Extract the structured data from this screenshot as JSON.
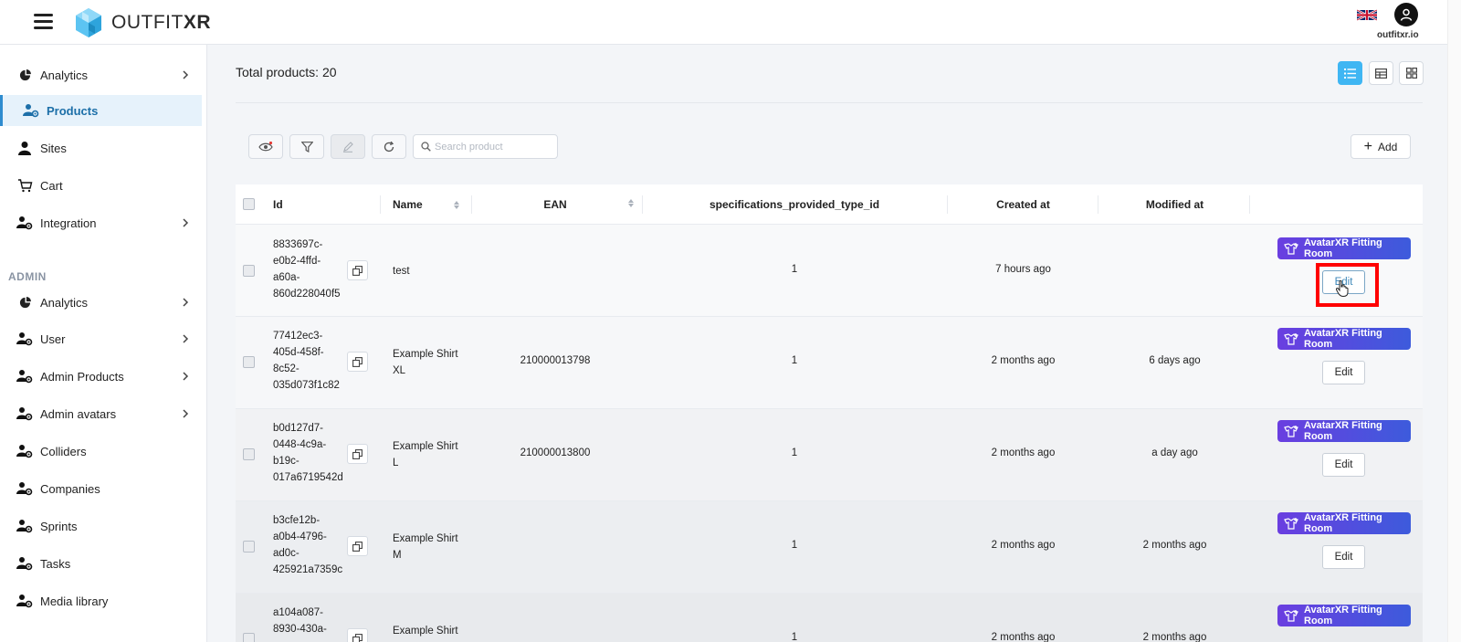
{
  "header": {
    "brand_prefix": "OUTFIT",
    "brand_suffix": "XR",
    "user_caption": "outfitxr.io",
    "language_flag": "uk-flag-icon"
  },
  "sidebar": {
    "items": [
      {
        "label": "Analytics",
        "icon": "pie-chart-icon",
        "has_chevron": true
      },
      {
        "label": "Products",
        "icon": "users-gear-icon",
        "active": true
      },
      {
        "label": "Sites",
        "icon": "user-icon"
      },
      {
        "label": "Cart",
        "icon": "cart-icon"
      },
      {
        "label": "Integration",
        "icon": "user-gear-icon",
        "has_chevron": true
      }
    ],
    "admin_label": "ADMIN",
    "admin_items": [
      {
        "label": "Analytics",
        "icon": "pie-chart-icon",
        "has_chevron": true
      },
      {
        "label": "User",
        "icon": "user-gear-icon",
        "has_chevron": true
      },
      {
        "label": "Admin Products",
        "icon": "user-gear-icon",
        "has_chevron": true
      },
      {
        "label": "Admin avatars",
        "icon": "user-gear-icon",
        "has_chevron": true
      },
      {
        "label": "Colliders",
        "icon": "user-gear-icon"
      },
      {
        "label": "Companies",
        "icon": "user-gear-icon"
      },
      {
        "label": "Sprints",
        "icon": "user-gear-icon"
      },
      {
        "label": "Tasks",
        "icon": "user-gear-icon"
      },
      {
        "label": "Media library",
        "icon": "user-gear-icon"
      }
    ]
  },
  "main": {
    "total_label": "Total products: 20",
    "search_placeholder": "Search product",
    "add_label": "Add",
    "active_view": "list"
  },
  "table": {
    "columns": {
      "id": "Id",
      "name": "Name",
      "ean": "EAN",
      "spec": "specifications_provided_type_id",
      "created": "Created at",
      "modified": "Modified at"
    },
    "fitting_room_label": "AvatarXR Fitting Room",
    "edit_label": "Edit",
    "rows": [
      {
        "id_lines": [
          "8833697c-",
          "e0b2-4ffd-",
          "a60a-",
          "860d228040f5"
        ],
        "name_lines": [
          "test"
        ],
        "ean": "",
        "spec": "1",
        "created": "7 hours ago",
        "modified": ""
      },
      {
        "id_lines": [
          "77412ec3-",
          "405d-458f-",
          "8c52-",
          "035d073f1c82"
        ],
        "name_lines": [
          "Example Shirt",
          "XL"
        ],
        "ean": "210000013798",
        "spec": "1",
        "created": "2 months ago",
        "modified": "6 days ago"
      },
      {
        "id_lines": [
          "b0d127d7-",
          "0448-4c9a-",
          "b19c-",
          "017a6719542d"
        ],
        "name_lines": [
          "Example Shirt",
          "L"
        ],
        "ean": "210000013800",
        "spec": "1",
        "created": "2 months ago",
        "modified": "a day ago"
      },
      {
        "id_lines": [
          "b3cfe12b-",
          "a0b4-4796-",
          "ad0c-",
          "425921a7359c"
        ],
        "name_lines": [
          "Example Shirt",
          "M"
        ],
        "ean": "",
        "spec": "1",
        "created": "2 months ago",
        "modified": "2 months ago"
      },
      {
        "id_lines": [
          "a104a087-",
          "8930-430a-"
        ],
        "name_lines": [
          "Example Shirt"
        ],
        "ean": "",
        "spec": "1",
        "created": "2 months ago",
        "modified": "2 months ago"
      }
    ]
  }
}
